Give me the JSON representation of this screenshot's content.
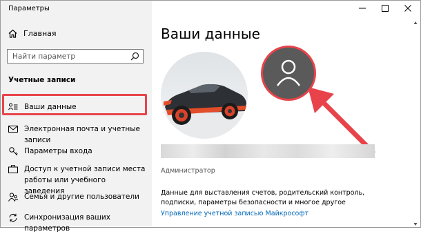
{
  "window": {
    "title": "Параметры"
  },
  "sidebar": {
    "home_label": "Главная",
    "search_placeholder": "Найти параметр",
    "section_title": "Учетные записи",
    "items": [
      {
        "label": "Ваши данные",
        "icon": "person-card-icon",
        "selected": true
      },
      {
        "label": "Электронная почта и учетные записи",
        "icon": "mail-icon"
      },
      {
        "label": "Параметры входа",
        "icon": "key-icon"
      },
      {
        "label": "Доступ к учетной записи места работы или учебного заведения",
        "icon": "briefcase-icon"
      },
      {
        "label": "Семья и другие пользователи",
        "icon": "people-icon"
      },
      {
        "label": "Синхронизация ваших параметров",
        "icon": "sync-icon"
      }
    ]
  },
  "main": {
    "title": "Ваши данные",
    "role": "Администратор",
    "description": "Данные для выставления счетов, родительский контроль, подписки, параметры безопасности и многое другое",
    "manage_link": "Управление учетной записью Майкрософт"
  },
  "colors": {
    "highlight": "#e8434a",
    "link": "#0067b8",
    "sidebar_bg": "#f2f2f2"
  }
}
